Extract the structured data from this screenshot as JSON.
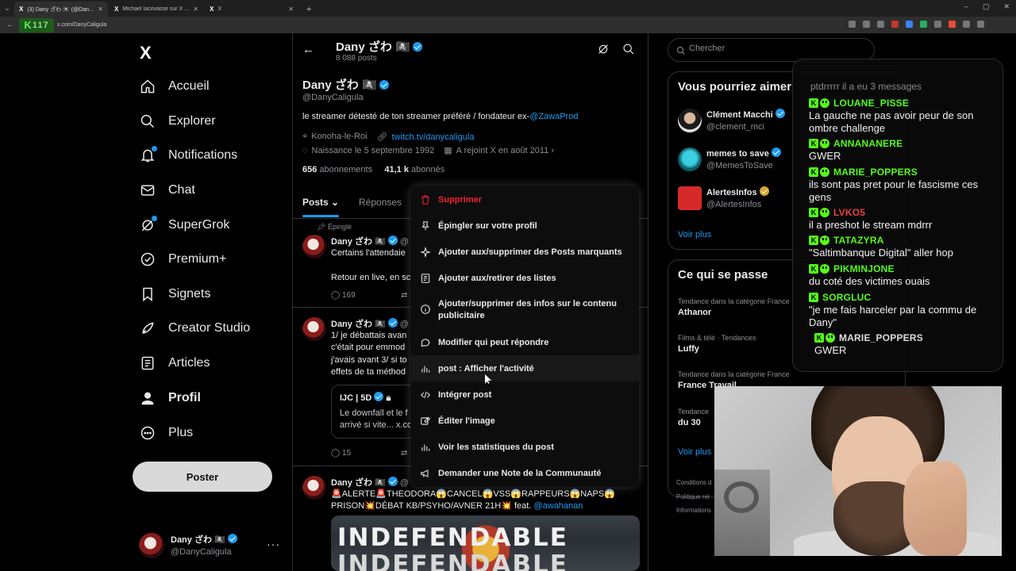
{
  "browser": {
    "tabs": [
      {
        "favicon": "X",
        "title": "(3) Dany ざわ 🏴‍☠️ (@DanyCaligula...",
        "active": true
      },
      {
        "favicon": "X",
        "title": "Michael Iacovasse sur X : \"Le s...",
        "active": false
      },
      {
        "favicon": "X",
        "title": "X",
        "active": false
      }
    ],
    "logo_text": "K",
    "logo_number": "117",
    "url": "x.com/DanyCaligula"
  },
  "sidebar": {
    "logo": "X",
    "items": [
      {
        "label": "Accueil",
        "icon": "home-icon"
      },
      {
        "label": "Explorer",
        "icon": "search-icon"
      },
      {
        "label": "Notifications",
        "icon": "bell-icon",
        "badge": "3"
      },
      {
        "label": "Chat",
        "icon": "mail-icon"
      },
      {
        "label": "SuperGrok",
        "icon": "grok-icon"
      },
      {
        "label": "Premium+",
        "icon": "premium-icon"
      },
      {
        "label": "Signets",
        "icon": "bookmark-icon"
      },
      {
        "label": "Creator Studio",
        "icon": "rocket-icon"
      },
      {
        "label": "Articles",
        "icon": "article-icon"
      },
      {
        "label": "Profil",
        "icon": "person-icon"
      },
      {
        "label": "Plus",
        "icon": "more-circle-icon"
      }
    ],
    "post_button": "Poster",
    "account": {
      "name": "Dany ざわ 🏴‍☠️",
      "handle": "@DanyCaligula"
    }
  },
  "profile": {
    "topbar_name": "Dany ざわ 🏴‍☠️",
    "posts_count": "8 088 posts",
    "name": "Dany ざわ 🏴‍☠️",
    "handle": "@DanyCaligula",
    "bio_text": "le streamer détesté de ton streamer préféré / fondateur ex-",
    "bio_link": "@ZawaProd",
    "location": "Konoha-le-Roi",
    "website": "twitch.tv/danycaligula",
    "birthday": "Naissance le 5 septembre 1992",
    "joined": "A rejoint X en août 2011",
    "following_count": "656",
    "following_label": "abonnements",
    "followers_count": "41,1 k",
    "followers_label": "abonnés",
    "tabs": [
      "Posts",
      "Réponses"
    ]
  },
  "tweets": [
    {
      "pinned_label": "Épinglé",
      "author": "Dany ざわ 🏴‍☠️",
      "handle_start": "@",
      "text": "Certains l'attendaie\n\nRetour en live, en sc",
      "replies": "169"
    },
    {
      "author": "Dany ざわ 🏴‍☠️",
      "handle_start": "@",
      "text": "1/ je débattais avan\nc'était pour emmod\nj'avais avant 3/ si to\neffets de ta méthod",
      "quote_author": "IJC | 5D",
      "quote_text": "Le downfall et le f\narrivé si vite... x.co",
      "replies": "15"
    },
    {
      "author": "Dany ざわ 🏴‍☠️",
      "handle_start": "@",
      "text": "🚨ALERTE🚨THEODORA😱CANCEL😱VSS😱RAPPEURS😱NAPS😱\nPRISON💥DÉBAT KB/PSYHO/AVNER 21H💥 feat. ",
      "mention": "@awahanan",
      "media_text": "INDEFENDABLE"
    }
  ],
  "menu": {
    "items": [
      {
        "label": "Supprimer",
        "icon": "trash-icon",
        "danger": true
      },
      {
        "label": "Épingler sur votre profil",
        "icon": "pin-icon"
      },
      {
        "label": "Ajouter aux/supprimer des Posts marquants",
        "icon": "sparkle-icon"
      },
      {
        "label": "Ajouter aux/retirer des listes",
        "icon": "list-icon"
      },
      {
        "label": "Ajouter/supprimer des infos sur le contenu",
        "label2": "publicitaire",
        "icon": "info-icon"
      },
      {
        "label": "Modifier qui peut répondre",
        "icon": "reply-icon"
      },
      {
        "label": "post : Afficher l'activité",
        "icon": "bar-chart-icon"
      },
      {
        "label": "Intégrer post",
        "icon": "code-icon"
      },
      {
        "label": "Éditer l'image",
        "icon": "edit-image-icon"
      },
      {
        "label": "Voir les statistiques du post",
        "icon": "stats-icon"
      },
      {
        "label": "Demander une Note de la Communauté",
        "icon": "megaphone-icon"
      }
    ]
  },
  "right": {
    "search_placeholder": "Chercher",
    "suggestions_title": "Vous pourriez aimer",
    "suggestions": [
      {
        "name": "Clément Macchi",
        "handle": "@clement_mci",
        "badge": "blue"
      },
      {
        "name": "memes to save",
        "handle": "@MemesToSave",
        "badge": "blue"
      },
      {
        "name": "AlertesInfos",
        "handle": "@AlertesInfos",
        "badge": "gold"
      }
    ],
    "see_more": "Voir plus",
    "trends_title": "Ce qui se passe",
    "trends": [
      {
        "category": "Tendance dans la catégorie France",
        "name": "Athanor"
      },
      {
        "category": "Films & télé · Tendances",
        "name": "Luffy"
      },
      {
        "category": "Tendance dans la catégorie France",
        "name": "France Travail"
      },
      {
        "category": "Tendance",
        "name": "du 30"
      }
    ],
    "trends_more": "Voir plus",
    "footer": [
      "Conditions d",
      "Politique rel",
      "Informations"
    ]
  },
  "chat": {
    "top_text": "ptdrrrrr il a eu 3 messages",
    "messages": [
      {
        "user": "LOUANE_PISSE",
        "text": "La gauche ne pas avoir peur de son ombre challenge"
      },
      {
        "user": "ANNANANERE",
        "text": "GWER"
      },
      {
        "user": "MARIE_POPPERS",
        "text": "ils sont pas pret pour le fascisme ces gens"
      },
      {
        "user": "LVKO5",
        "text": "il a preshot le stream mdrrr"
      },
      {
        "user": "TATAZYRA",
        "text": "\"Saltimbanque Digital\" aller hop"
      },
      {
        "user": "PIKMINJONE",
        "text": "du coté des victimes ouais"
      },
      {
        "user": "SORGLUC",
        "text": "\"je me fais harceler par la commu de Dany\""
      },
      {
        "user": "MARIE_POPPERS",
        "text": "GWER"
      }
    ]
  },
  "colors": {
    "accent": "#1d9bf0",
    "danger": "#f4212e",
    "kick_green": "#53fc18"
  }
}
